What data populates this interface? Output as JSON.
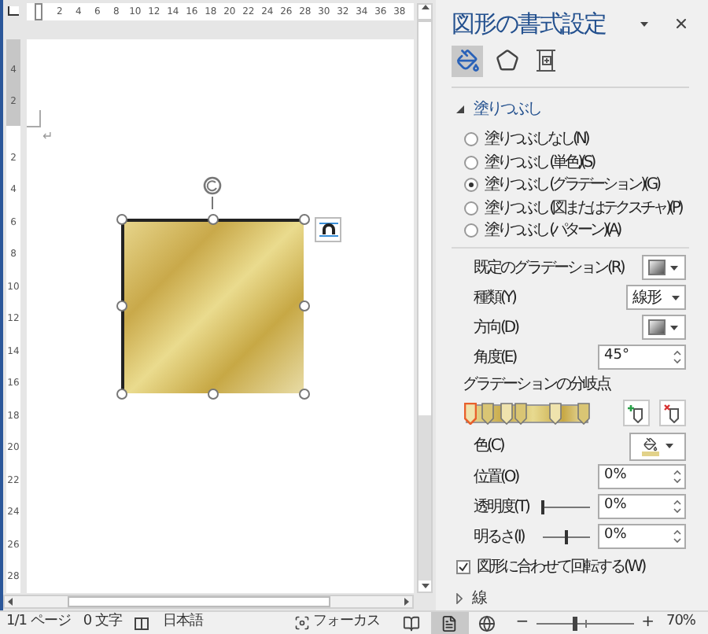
{
  "ruler": {
    "h_labels": [
      "2",
      "4",
      "6",
      "8",
      "10",
      "12",
      "14",
      "16",
      "18",
      "20",
      "22",
      "24",
      "26",
      "28",
      "30",
      "32",
      "34",
      "36",
      "38"
    ],
    "v_margin_labels": [
      "4",
      "2"
    ],
    "v_labels": [
      "2",
      "4",
      "6",
      "8",
      "10",
      "12",
      "14",
      "16",
      "18",
      "20",
      "22",
      "24",
      "26",
      "28"
    ]
  },
  "document": {
    "paragraph_mark": "↵"
  },
  "panel": {
    "title": "図形の書式設定",
    "tabs": [
      {
        "kind": "fill",
        "selected": true
      },
      {
        "kind": "effects",
        "selected": false
      },
      {
        "kind": "size",
        "selected": false
      }
    ],
    "fill": {
      "title": "塗りつぶし",
      "expanded": true,
      "options": [
        {
          "label": "塗りつぶしなし(N)",
          "selected": false
        },
        {
          "label": "塗りつぶし (単色)(S)",
          "selected": false
        },
        {
          "label": "塗りつぶし (グラデーション)(G)",
          "selected": true
        },
        {
          "label": "塗りつぶし (図またはテクスチャ)(P)",
          "selected": false
        },
        {
          "label": "塗りつぶし (パターン)(A)",
          "selected": false
        }
      ],
      "controls": [
        {
          "kind": "swatch",
          "label": "既定のグラデーション(R)"
        },
        {
          "kind": "dropdown",
          "label": "種類(Y)",
          "value": "線形"
        },
        {
          "kind": "swatch",
          "label": "方向(D)"
        },
        {
          "kind": "spin",
          "label": "角度(E)",
          "value": "45°"
        },
        {
          "kind": "stops",
          "label": "グラデーションの分岐点",
          "stops": [
            {
              "level": 0.02,
              "selected": true
            },
            {
              "level": 0.17,
              "selected": false
            },
            {
              "level": 0.33,
              "selected": false
            },
            {
              "level": 0.45,
              "selected": false
            },
            {
              "level": 0.74,
              "selected": false
            },
            {
              "level": 0.97,
              "selected": false
            }
          ]
        },
        {
          "kind": "color",
          "label": "色(C)"
        },
        {
          "kind": "spin",
          "label": "位置(O)",
          "value": "0%"
        },
        {
          "kind": "slider",
          "label": "透明度(T)",
          "level": 0,
          "value": "0%"
        },
        {
          "kind": "slider",
          "label": "明るさ(I)",
          "level": 0.5,
          "value": "0%"
        }
      ],
      "rotate_with_shape": {
        "label": "図形に合わせて回転する(W)",
        "checked": true
      }
    },
    "line": {
      "title": "線",
      "expanded": false
    }
  },
  "status_bar": {
    "page": "1/1 ページ",
    "words": "0 文字",
    "language": "日本語",
    "focus": "フォーカス",
    "views": [
      {
        "kind": "read",
        "selected": false
      },
      {
        "kind": "print",
        "selected": true
      },
      {
        "kind": "web",
        "selected": false
      }
    ],
    "zoom_out": "−",
    "zoom_in": "+",
    "zoom_slider": {
      "level": 0.4
    },
    "zoom": "70%"
  }
}
